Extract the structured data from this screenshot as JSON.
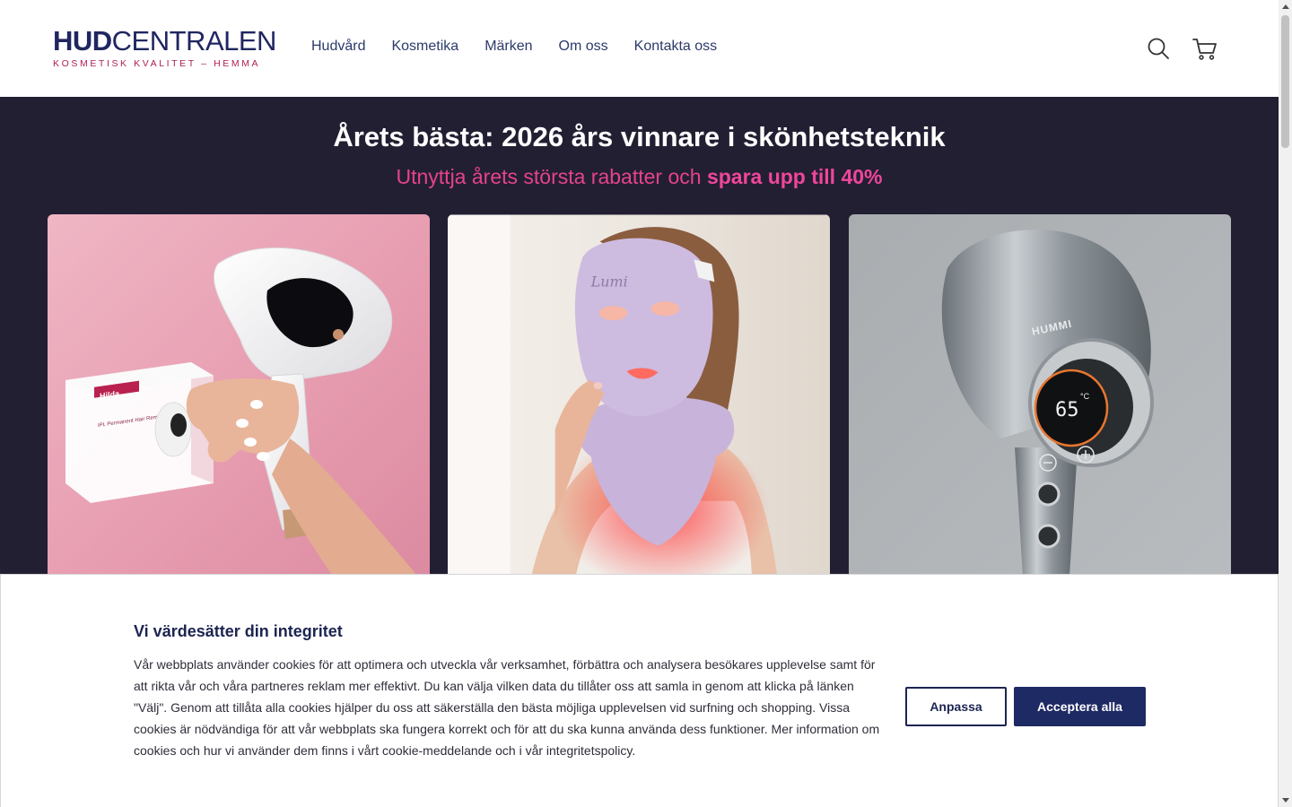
{
  "header": {
    "logo_bold": "HUD",
    "logo_light": "CENTRALEN",
    "logo_tagline": "KOSMETISK KVALITET – HEMMA",
    "nav": [
      {
        "label": "Hudvård"
      },
      {
        "label": "Kosmetika"
      },
      {
        "label": "Märken"
      },
      {
        "label": "Om oss"
      },
      {
        "label": "Kontakta oss"
      }
    ],
    "icons": {
      "search": "search-icon",
      "cart": "cart-icon"
    }
  },
  "hero": {
    "title": "Årets bästa: 2026 års vinnare i skönhetsteknik",
    "subtitle_prefix": "Utnyttja årets största rabatter och ",
    "subtitle_highlight": "spara upp till 40%",
    "colors": {
      "background": "#221f33",
      "accent": "#e6438b"
    },
    "product_images": [
      {
        "name": "ipl-hair-removal-device",
        "box_brand": "Hilda",
        "box_text": "IPL Permanent Hair Removal Device"
      },
      {
        "name": "led-light-therapy-mask",
        "mask_text": "Lumi"
      },
      {
        "name": "hair-dryer",
        "brand_text": "HUMMI",
        "display_value": "65",
        "display_unit": "°C"
      }
    ]
  },
  "cookie_banner": {
    "title": "Vi värdesätter din integritet",
    "body": "Vår webbplats använder cookies för att optimera och utveckla vår verksamhet, förbättra och analysera besökares upplevelse samt för att rikta vår och våra partneres reklam mer effektivt. Du kan välja vilken data du tillåter oss att samla in genom att klicka på länken \"Välj\". Genom att tillåta alla cookies hjälper du oss att säkerställa den bästa möjliga upplevelsen vid surfning och shopping. Vissa cookies är nödvändiga för att vår webbplats ska fungera korrekt och för att du ska kunna använda dess funktioner. Mer information om cookies och hur vi använder dem finns i vårt cookie-meddelande och i vår integritetspolicy.",
    "customize_label": "Anpassa",
    "accept_label": "Acceptera alla",
    "colors": {
      "primary": "#1e2a63"
    }
  }
}
